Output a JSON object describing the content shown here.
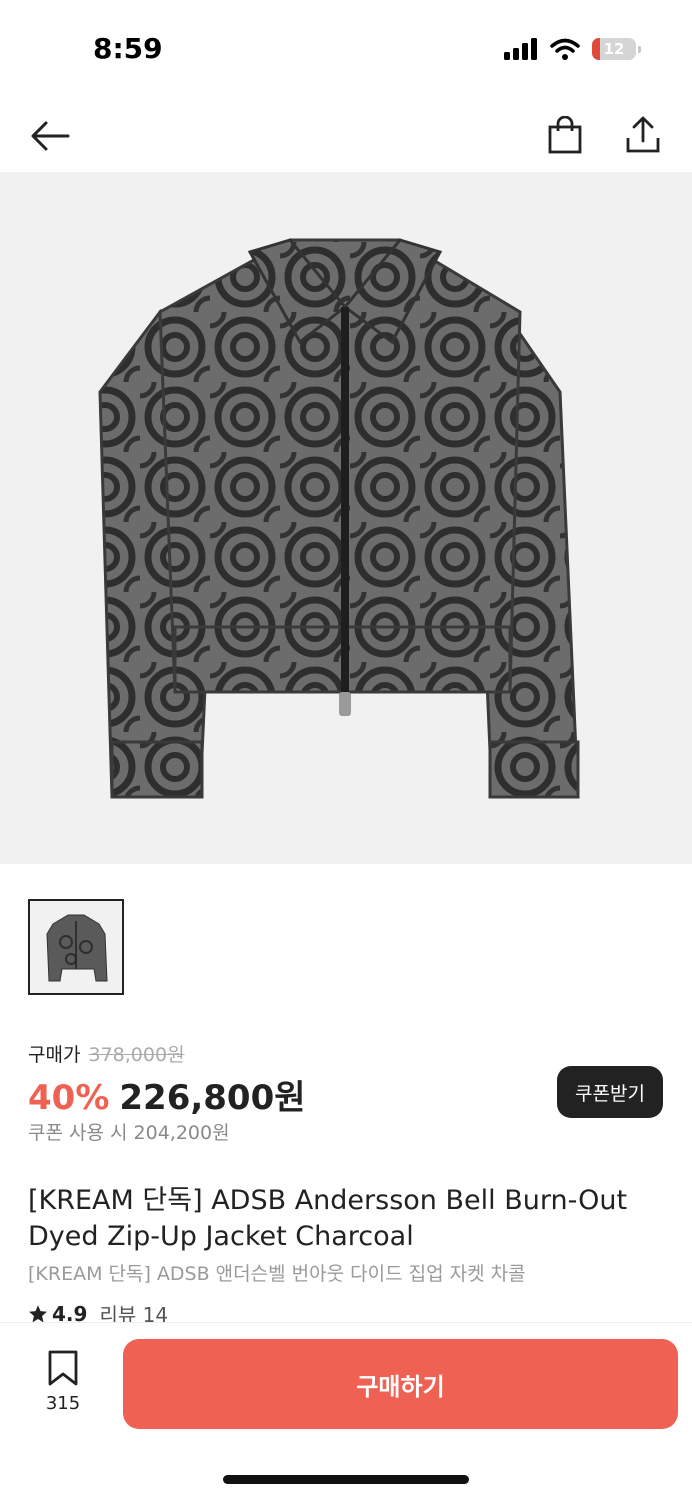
{
  "status": {
    "time": "8:59",
    "battery": "12"
  },
  "price": {
    "label": "구매가",
    "original": "378,000원",
    "discount": "40%",
    "current": "226,800원",
    "coupon_price": "쿠폰 사용 시 204,200원",
    "coupon_button": "쿠폰받기"
  },
  "product": {
    "title": "[KREAM 단독] ADSB Andersson Bell Burn-Out Dyed Zip-Up Jacket Charcoal",
    "subtitle": "[KREAM 단독] ADSB 앤더슨벨 번아웃 다이드 집업 자켓 차콜",
    "rating": "4.9",
    "reviews": "리뷰 14"
  },
  "bottom": {
    "bookmark_count": "315",
    "buy_label": "구매하기"
  },
  "icons": [
    "back-arrow-icon",
    "shopping-bag-icon",
    "share-icon",
    "star-icon",
    "bookmark-icon",
    "signal-icon",
    "wifi-icon",
    "battery-icon"
  ],
  "colors": {
    "accent": "#ef6253",
    "dark": "#222222",
    "image_bg": "#f1f1f1"
  }
}
